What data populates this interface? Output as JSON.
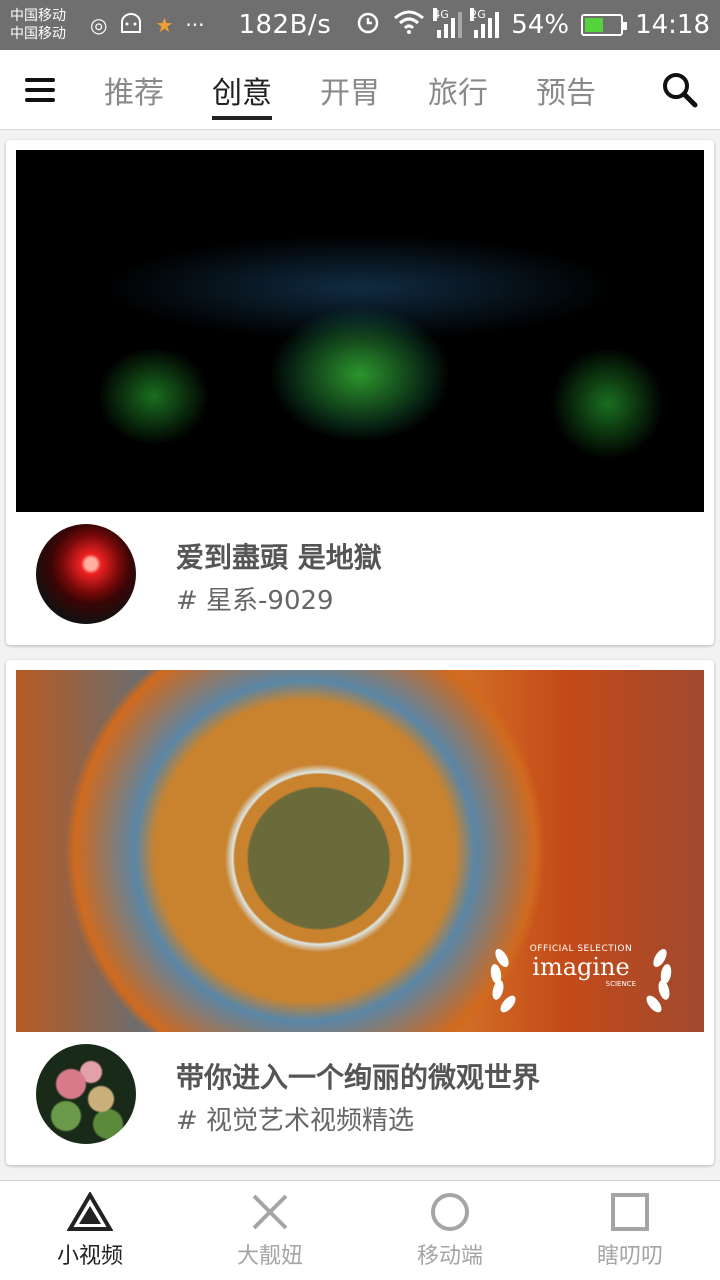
{
  "status_bar": {
    "carrier_1": "中国移动",
    "carrier_2": "中国移动",
    "net_speed": "182B/s",
    "net_4g": "4G",
    "net_2g": "2G",
    "battery": "54%",
    "battery_level": 0.54,
    "time": "14:18",
    "battery_color": "#56d23c"
  },
  "top_nav": {
    "tabs": [
      {
        "label": "推荐",
        "active": false
      },
      {
        "label": "创意",
        "active": true
      },
      {
        "label": "开胃",
        "active": false
      },
      {
        "label": "旅行",
        "active": false
      },
      {
        "label": "预告",
        "active": false
      }
    ],
    "menu_icon": "hamburger-icon",
    "search_icon": "search-icon"
  },
  "feed": {
    "cards": [
      {
        "title": "爱到盡頭 是地獄",
        "tag": "# 星系-9029"
      },
      {
        "title": "带你进入一个绚丽的微观世界",
        "tag": "# 视觉艺术视频精选",
        "badge": {
          "official": "OFFICIAL SELECTION",
          "name": "imagine",
          "sub": "SCIENCE"
        }
      }
    ]
  },
  "bottom_nav": {
    "items": [
      {
        "label": "小视频",
        "icon": "triangle-icon",
        "active": true
      },
      {
        "label": "大靓妞",
        "icon": "cross-icon",
        "active": false
      },
      {
        "label": "移动端",
        "icon": "circle-icon",
        "active": false
      },
      {
        "label": "瞎叨叨",
        "icon": "square-icon",
        "active": false
      }
    ]
  }
}
